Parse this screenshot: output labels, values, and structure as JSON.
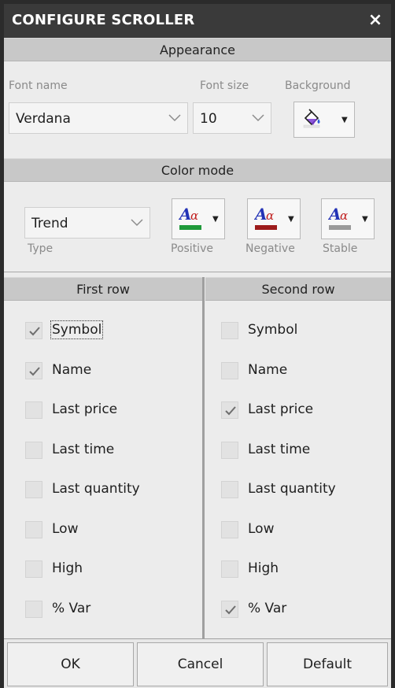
{
  "window": {
    "title": "CONFIGURE SCROLLER",
    "close_label": "×"
  },
  "appearance": {
    "header": "Appearance",
    "font_name_label": "Font name",
    "font_name_value": "Verdana",
    "font_size_label": "Font size",
    "font_size_value": "10",
    "background_label": "Background"
  },
  "color_mode": {
    "header": "Color mode",
    "type_label": "Type",
    "type_value": "Trend",
    "positive_label": "Positive",
    "negative_label": "Negative",
    "stable_label": "Stable",
    "positive_color": "#1f9a3a",
    "negative_color": "#9c1b1b",
    "stable_color": "#9a9a9a"
  },
  "first_row": {
    "header": "First row",
    "items": [
      {
        "label": "Symbol",
        "checked": true
      },
      {
        "label": "Name",
        "checked": true
      },
      {
        "label": "Last price",
        "checked": false
      },
      {
        "label": "Last time",
        "checked": false
      },
      {
        "label": "Last quantity",
        "checked": false
      },
      {
        "label": "Low",
        "checked": false
      },
      {
        "label": "High",
        "checked": false
      },
      {
        "label": "% Var",
        "checked": false
      }
    ]
  },
  "second_row": {
    "header": "Second row",
    "items": [
      {
        "label": "Symbol",
        "checked": false
      },
      {
        "label": "Name",
        "checked": false
      },
      {
        "label": "Last price",
        "checked": true
      },
      {
        "label": "Last time",
        "checked": false
      },
      {
        "label": "Last quantity",
        "checked": false
      },
      {
        "label": "Low",
        "checked": false
      },
      {
        "label": "High",
        "checked": false
      },
      {
        "label": "% Var",
        "checked": true
      }
    ]
  },
  "buttons": {
    "ok": "OK",
    "cancel": "Cancel",
    "default": "Default"
  },
  "icons": {
    "background": "paint-bucket-icon",
    "font_color": "font-color-icon",
    "dropdown": "chevron-down-icon",
    "check": "checkmark-icon"
  }
}
